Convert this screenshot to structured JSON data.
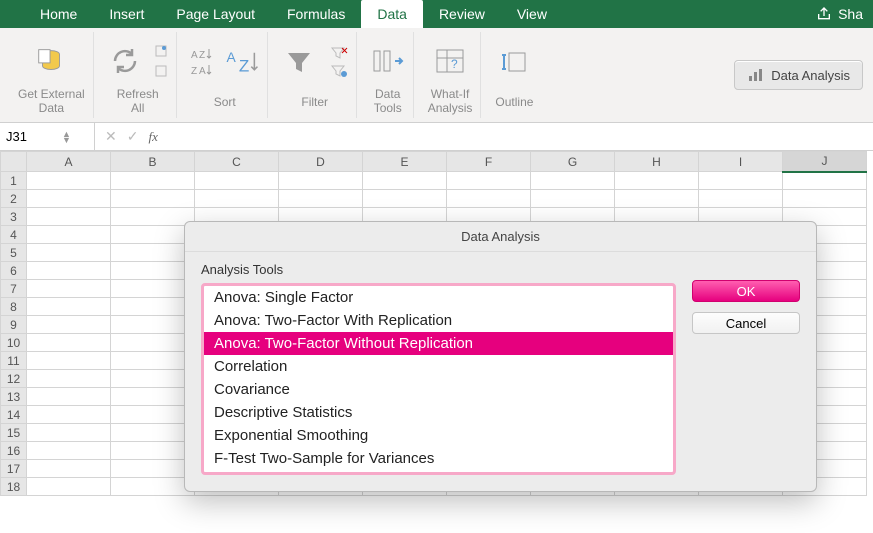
{
  "tabs": {
    "items": [
      "Home",
      "Insert",
      "Page Layout",
      "Formulas",
      "Data",
      "Review",
      "View"
    ],
    "active_index": 4,
    "share_label": "Sha"
  },
  "ribbon": {
    "groups": [
      {
        "label": "Get External\nData",
        "icon": "database-icon"
      },
      {
        "label": "Refresh\nAll",
        "icon": "refresh-icon"
      },
      {
        "label": "Sort",
        "icon": "sort-icon"
      },
      {
        "label": "Filter",
        "icon": "filter-icon"
      },
      {
        "label": "Data\nTools",
        "icon": "datatools-icon"
      },
      {
        "label": "What-If\nAnalysis",
        "icon": "whatif-icon"
      },
      {
        "label": "Outline",
        "icon": "outline-icon"
      }
    ],
    "data_analysis_btn": "Data Analysis"
  },
  "formula_bar": {
    "name_box": "J31",
    "fx_label": "fx",
    "formula_value": ""
  },
  "grid": {
    "columns": [
      "A",
      "B",
      "C",
      "D",
      "E",
      "F",
      "G",
      "H",
      "I",
      "J"
    ],
    "active_col_index": 9,
    "rows": 18
  },
  "dialog": {
    "title": "Data Analysis",
    "section_label": "Analysis Tools",
    "items": [
      "Anova: Single Factor",
      "Anova: Two-Factor With Replication",
      "Anova: Two-Factor Without Replication",
      "Correlation",
      "Covariance",
      "Descriptive Statistics",
      "Exponential Smoothing",
      "F-Test Two-Sample for Variances"
    ],
    "selected_index": 2,
    "ok_label": "OK",
    "cancel_label": "Cancel"
  }
}
